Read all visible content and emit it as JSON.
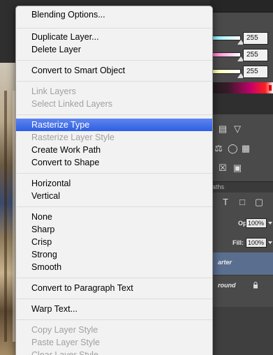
{
  "background": {
    "color_values": [
      "255",
      "255",
      "255"
    ],
    "tab_paths": "aths",
    "opacity_label": "Opacity:",
    "opacity_value": "100%",
    "fill_label": "Fill:",
    "fill_value": "100%",
    "layers": [
      {
        "name": "arter",
        "selected": true
      },
      {
        "name": "round",
        "selected": false
      }
    ],
    "adjustment_icons": [
      "levels-icon",
      "triangle-icon",
      "balance-icon",
      "channel-mixer-icon",
      "grid-icon",
      "invert-icon",
      "gradient-map-icon"
    ],
    "layer_tool_icons": [
      "type-icon",
      "transform-icon",
      "smart-object-icon"
    ]
  },
  "menu": {
    "items": [
      {
        "label": "Blending Options...",
        "state": "enabled"
      },
      {
        "label": "Duplicate Layer...",
        "state": "enabled"
      },
      {
        "label": "Delete Layer",
        "state": "enabled"
      },
      {
        "label": "Convert to Smart Object",
        "state": "enabled"
      },
      {
        "label": "Link Layers",
        "state": "disabled"
      },
      {
        "label": "Select Linked Layers",
        "state": "disabled"
      },
      {
        "label": "Rasterize Type",
        "state": "highlighted"
      },
      {
        "label": "Rasterize Layer Style",
        "state": "disabled"
      },
      {
        "label": "Create Work Path",
        "state": "enabled"
      },
      {
        "label": "Convert to Shape",
        "state": "enabled"
      },
      {
        "label": "Horizontal",
        "state": "enabled"
      },
      {
        "label": "Vertical",
        "state": "enabled"
      },
      {
        "label": "None",
        "state": "enabled"
      },
      {
        "label": "Sharp",
        "state": "enabled"
      },
      {
        "label": "Crisp",
        "state": "enabled"
      },
      {
        "label": "Strong",
        "state": "enabled"
      },
      {
        "label": "Smooth",
        "state": "enabled"
      },
      {
        "label": "Convert to Paragraph Text",
        "state": "enabled"
      },
      {
        "label": "Warp Text...",
        "state": "enabled"
      },
      {
        "label": "Copy Layer Style",
        "state": "disabled"
      },
      {
        "label": "Paste Layer Style",
        "state": "disabled"
      },
      {
        "label": "Clear Layer Style",
        "state": "disabled"
      }
    ]
  },
  "colors": {
    "menu_bg": "#f2f2f2",
    "highlight": "#2e5fe3",
    "disabled_text": "#a0a0a0",
    "panel_bg": "#4a4a4a",
    "selected_layer": "#5a6f8f"
  }
}
